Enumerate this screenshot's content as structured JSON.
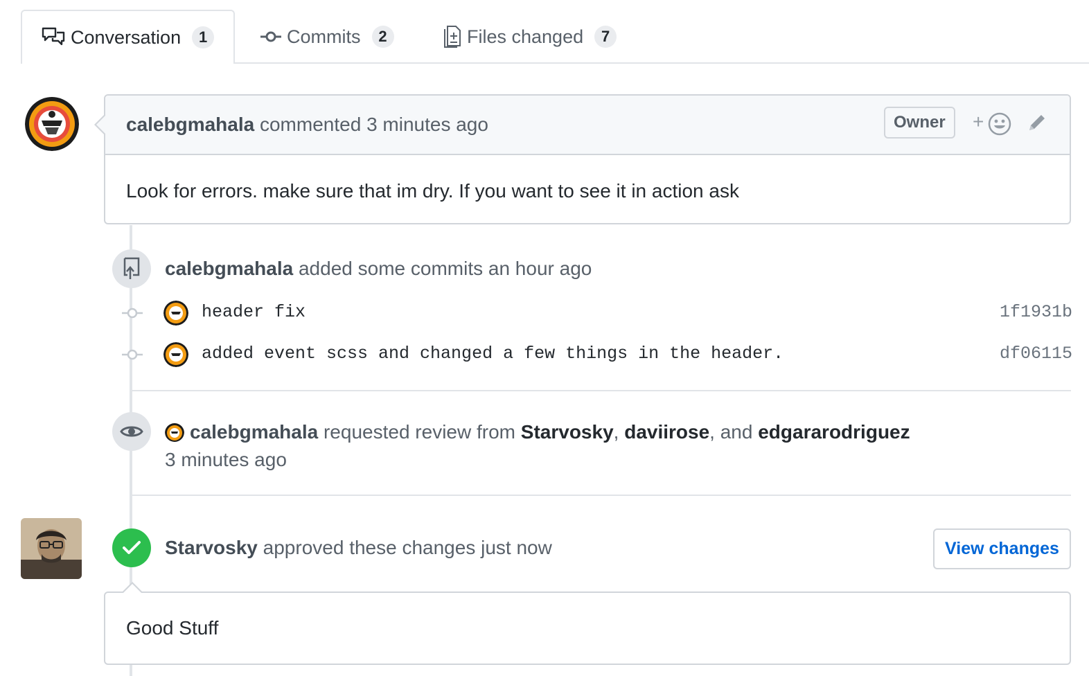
{
  "tabs": [
    {
      "label": "Conversation",
      "count": "1",
      "icon": "comment-discussion-icon",
      "active": true
    },
    {
      "label": "Commits",
      "count": "2",
      "icon": "git-commit-icon",
      "active": false
    },
    {
      "label": "Files changed",
      "count": "7",
      "icon": "file-diff-icon",
      "active": false
    }
  ],
  "comment": {
    "author": "calebgmahala",
    "action": "commented",
    "time": "3 minutes ago",
    "badge": "Owner",
    "emoji_plus": "+",
    "body": "Look for errors. make sure that im dry. If you want to see it in action ask"
  },
  "commits_event": {
    "author": "calebgmahala",
    "text": "added some commits an hour ago",
    "commits": [
      {
        "message": "header fix",
        "sha": "1f1931b"
      },
      {
        "message": "added event scss and changed a few things in the header.",
        "sha": "df06115"
      }
    ]
  },
  "review_request": {
    "author": "calebgmahala",
    "text": "requested review from",
    "reviewers": [
      "Starvosky",
      "daviirose",
      "edgararodriguez"
    ],
    "sep1": ",",
    "sep2": ", and",
    "time": "3 minutes ago"
  },
  "approval": {
    "author": "Starvosky",
    "text": "approved these changes just now",
    "button": "View changes",
    "comment": "Good Stuff"
  },
  "colors": {
    "link": "#0366d6",
    "approved": "#2cbe4e",
    "border": "#d1d5da",
    "header_bg": "#f6f8fa"
  }
}
